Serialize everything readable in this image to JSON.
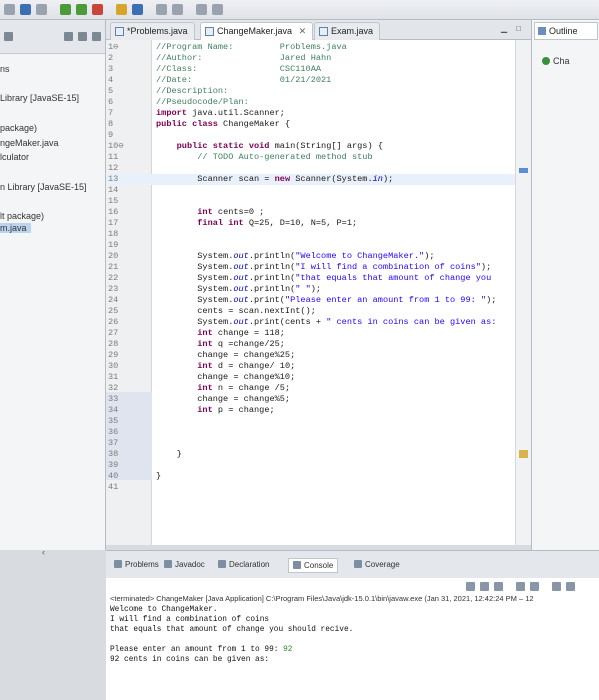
{
  "editor": {
    "tabs": [
      {
        "label": "*Problems.java",
        "active": false
      },
      {
        "label": "ChangeMaker.java",
        "active": true,
        "close": "✕"
      },
      {
        "label": "Exam.java",
        "active": false
      }
    ],
    "lines": [
      {
        "n": "1⊖",
        "html": "<span class=\"cm\">//Program Name:         Problems.java</span>"
      },
      {
        "n": "2",
        "html": "<span class=\"cm\">//Author:               Jared Hahn</span>"
      },
      {
        "n": "3",
        "html": "<span class=\"cm\">//Class:                CSC110AA</span>"
      },
      {
        "n": "4",
        "html": "<span class=\"cm\">//Date:                 01/21/2021</span>"
      },
      {
        "n": "5",
        "html": "<span class=\"cm\">//Description:</span>"
      },
      {
        "n": "6",
        "html": "<span class=\"cm\">//Pseudocode/Plan:</span>"
      },
      {
        "n": "7",
        "html": "<span class=\"kw\">import</span> java.util.Scanner;"
      },
      {
        "n": "8",
        "html": "<span class=\"kw\">public class</span> ChangeMaker {"
      },
      {
        "n": "9",
        "html": ""
      },
      {
        "n": "10⊖",
        "html": "    <span class=\"kw\">public static void</span> main(String[] args) {"
      },
      {
        "n": "11",
        "html": "        <span class=\"cm\">// TODO Auto-generated method stub</span>"
      },
      {
        "n": "12",
        "html": ""
      },
      {
        "n": "13",
        "html": "        Scanner scan = <span class=\"kw\">new</span> Scanner(System.<span class=\"fd\">in</span>);"
      },
      {
        "n": "14",
        "html": ""
      },
      {
        "n": "15",
        "html": ""
      },
      {
        "n": "16",
        "html": "        <span class=\"kw\">int</span> cents=0 ;"
      },
      {
        "n": "17",
        "html": "        <span class=\"kw\">final int</span> Q=25, D=10, N=5, P=1;"
      },
      {
        "n": "18",
        "html": ""
      },
      {
        "n": "19",
        "html": ""
      },
      {
        "n": "20",
        "html": "        System.<span class=\"fd\">out</span>.println(<span class=\"st\">\"Welcome to ChangeMaker.\"</span>);"
      },
      {
        "n": "21",
        "html": "        System.<span class=\"fd\">out</span>.println(<span class=\"st\">\"I will find a combination of coins\"</span>);"
      },
      {
        "n": "22",
        "html": "        System.<span class=\"fd\">out</span>.println(<span class=\"st\">\"that equals that amount of change you </span>"
      },
      {
        "n": "23",
        "html": "        System.<span class=\"fd\">out</span>.println(<span class=\"st\">\" \"</span>);"
      },
      {
        "n": "24",
        "html": "        System.<span class=\"fd\">out</span>.print(<span class=\"st\">\"Please enter an amount from 1 to 99: \"</span>);"
      },
      {
        "n": "25",
        "html": "        cents = scan.nextInt();"
      },
      {
        "n": "26",
        "html": "        System.<span class=\"fd\">out</span>.print(cents + <span class=\"st\">\" cents in coins can be given as:</span>"
      },
      {
        "n": "27",
        "html": "        <span class=\"kw\">int</span> change = 118;"
      },
      {
        "n": "28",
        "html": "        <span class=\"kw\">int</span> q =change/25;"
      },
      {
        "n": "29",
        "html": "        change = change%25;"
      },
      {
        "n": "30",
        "html": "        <span class=\"kw\">int</span> d = change/ 10;"
      },
      {
        "n": "31",
        "html": "        change = change%10;"
      },
      {
        "n": "32",
        "html": "        <span class=\"kw\">int</span> n = change /5;"
      },
      {
        "n": "33",
        "html": "        change = change%5;"
      },
      {
        "n": "34",
        "html": "        <span class=\"kw\">int</span> p = change;"
      },
      {
        "n": "35",
        "html": ""
      },
      {
        "n": "36",
        "html": ""
      },
      {
        "n": "37",
        "html": ""
      },
      {
        "n": "38",
        "html": "    }"
      },
      {
        "n": "39",
        "html": ""
      },
      {
        "n": "40",
        "html": "}"
      },
      {
        "n": "41",
        "html": ""
      }
    ]
  },
  "explorer": {
    "items": [
      {
        "label": "ns"
      },
      {
        "label": "Library [JavaSE-15]"
      },
      {
        "label": "package)"
      },
      {
        "label": "ngeMaker.java"
      },
      {
        "label": "lculator"
      },
      {
        "label": "n Library [JavaSE-15]"
      },
      {
        "label": "lt package)"
      },
      {
        "label": "m.java"
      }
    ]
  },
  "outline": {
    "tab_label": "Outline",
    "items": [
      {
        "label": "Cha"
      }
    ]
  },
  "bottom": {
    "tabs": [
      {
        "label": "Problems"
      },
      {
        "label": "Javadoc"
      },
      {
        "label": "Declaration"
      },
      {
        "label": "Console"
      },
      {
        "label": "Coverage"
      }
    ],
    "console": {
      "terminated": "<terminated> ChangeMaker [Java Application] C:\\Program Files\\Java\\jdk-15.0.1\\bin\\javaw.exe (Jan 31, 2021, 12:42:24 PM – 12",
      "lines": [
        "Welcome to ChangeMaker.",
        "I will find a combination of coins",
        "that equals that amount of change you should recive.",
        "",
        "Please enter an amount from 1 to 99: "
      ],
      "input": "92",
      "last": "92 cents in coins can be given as:"
    }
  }
}
